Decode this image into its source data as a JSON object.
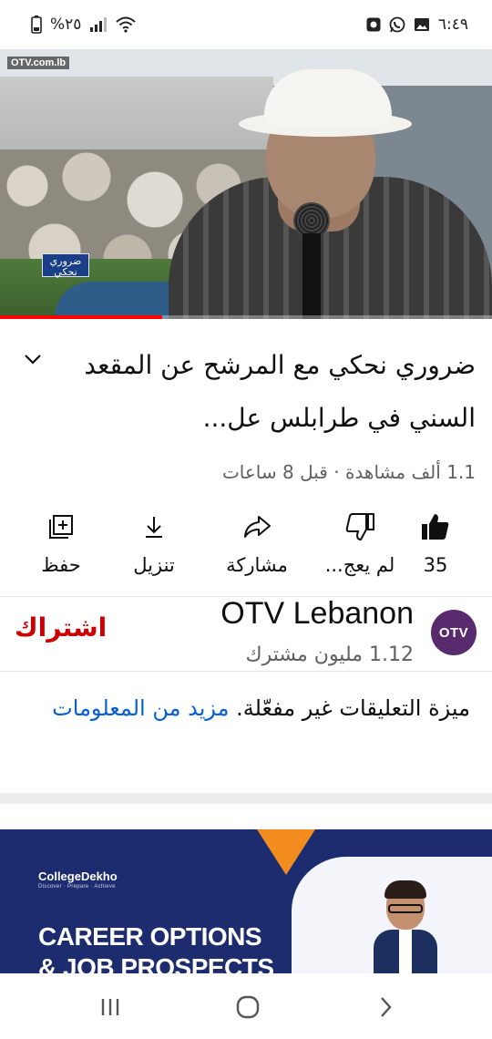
{
  "status_bar": {
    "time": "٦:٤٩",
    "battery": "%٢٥",
    "icons": [
      "photo-icon",
      "whatsapp-icon",
      "record-icon",
      "wifi-icon",
      "signal-icon",
      "battery-icon"
    ]
  },
  "video": {
    "watermark": "OTV.com.lb",
    "tag": "ضروري نحكي",
    "progress": 0.33
  },
  "title": {
    "text": "ضروري نحكي مع المرشح عن المقعد السني في طرابلس عل..."
  },
  "meta": {
    "text": "1.1 ألف مشاهدة · قبل 8 ساعات"
  },
  "actions": {
    "like_count": "35",
    "dislike_label": "لم يعج...",
    "share_label": "مشاركة",
    "download_label": "تنزيل",
    "save_label": "حفظ"
  },
  "channel": {
    "name": "OTV Lebanon",
    "avatar_text": "OTV",
    "subscribers": "1.12 مليون مشترك",
    "subscribe_label": "اشتراك"
  },
  "comments": {
    "text": "ميزة التعليقات غير مفعّلة.",
    "more_link": "مزيد من المعلومات"
  },
  "ad": {
    "brand": "CollegeDekho",
    "tagline": "Discover · Prepare · Achieve",
    "line1": "CAREER OPTIONS",
    "line2": "& JOB PROSPECTS"
  },
  "colors": {
    "accent_red": "#cc0000",
    "link_blue": "#065fd4",
    "secondary_text": "#606060",
    "ad_bg": "#1d2c6e"
  }
}
